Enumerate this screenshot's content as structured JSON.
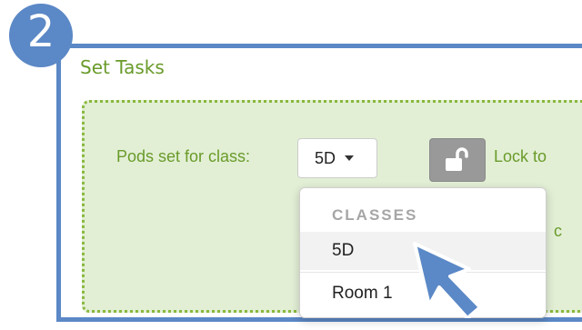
{
  "step": {
    "number": "2"
  },
  "section": {
    "title": "Set Tasks"
  },
  "controls": {
    "pods_label": "Pods set for class:",
    "class_select_value": "5D",
    "lock_label": "Lock to",
    "partial_text": "c"
  },
  "dropdown": {
    "header": "CLASSES",
    "items": [
      {
        "label": "5D",
        "highlighted": true
      },
      {
        "label": "Room 1",
        "highlighted": false
      }
    ]
  },
  "icons": {
    "lock_button": "unlock-icon",
    "cursor": "cursor-arrow-icon",
    "caret": "chevron-down-icon"
  },
  "colors": {
    "accent_blue": "#5b88c6",
    "green_text": "#6a9b2a",
    "panel_fill": "#e2efd5",
    "panel_border": "#89b83e",
    "lock_button_bg": "#999999"
  }
}
